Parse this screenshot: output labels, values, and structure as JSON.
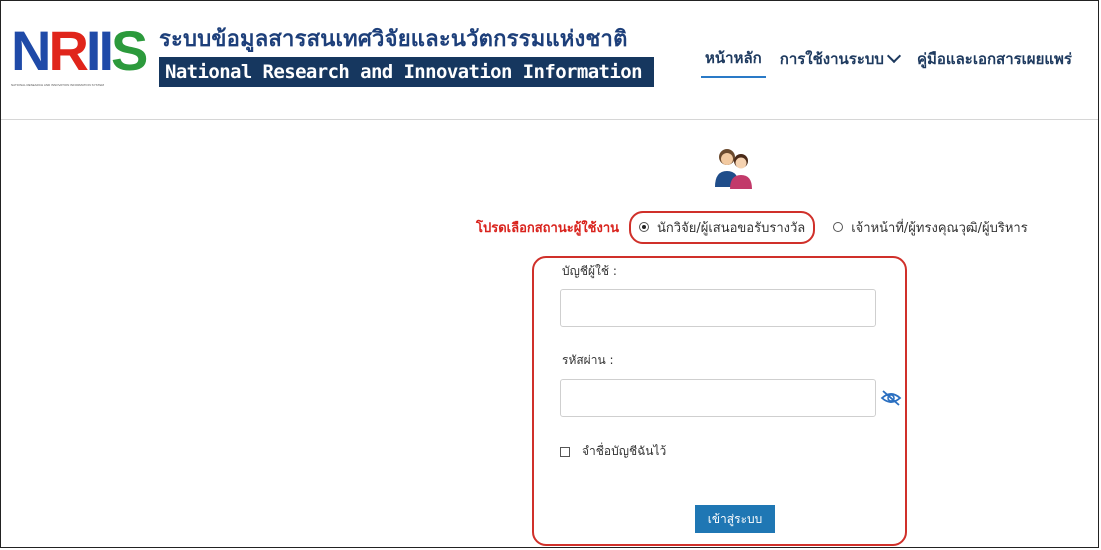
{
  "header": {
    "logo": {
      "text_n": "N",
      "text_r": "R",
      "text_ii": "II",
      "text_s": "S",
      "subtext": "NATIONAL RESEARCH AND INNOVATION INFORMATION SYSTEM"
    },
    "title_th": "ระบบข้อมูลสารสนเทศวิจัยและนวัตกรรมแห่งชาติ",
    "title_en": "National Research and Innovation Information System"
  },
  "nav": {
    "items": [
      {
        "label": "หน้าหลัก",
        "active": true
      },
      {
        "label": "การใช้งานระบบ",
        "dropdown": true
      },
      {
        "label": "คู่มือและเอกสารเผยแพร่"
      }
    ]
  },
  "role": {
    "prompt": "โปรดเลือกสถานะผู้ใช้งาน",
    "options": [
      {
        "label": "นักวิจัย/ผู้เสนอขอรับรางวัล",
        "selected": true
      },
      {
        "label": "เจ้าหน้าที่/ผู้ทรงคุณวุฒิ/ผู้บริหาร",
        "selected": false
      }
    ]
  },
  "form": {
    "username_label": "บัญชีผู้ใช้ :",
    "username_value": "",
    "password_label": "รหัสผ่าน :",
    "password_value": "",
    "remember_label": "จำชื่อบัญชีฉันไว้",
    "submit_label": "เข้าสู่ระบบ"
  },
  "colors": {
    "accent_blue": "#1f77b4",
    "highlight_red": "#d0302a",
    "header_navy": "#16375f"
  },
  "icons": {
    "user": "users-icon",
    "eye": "eye-slash-icon"
  }
}
